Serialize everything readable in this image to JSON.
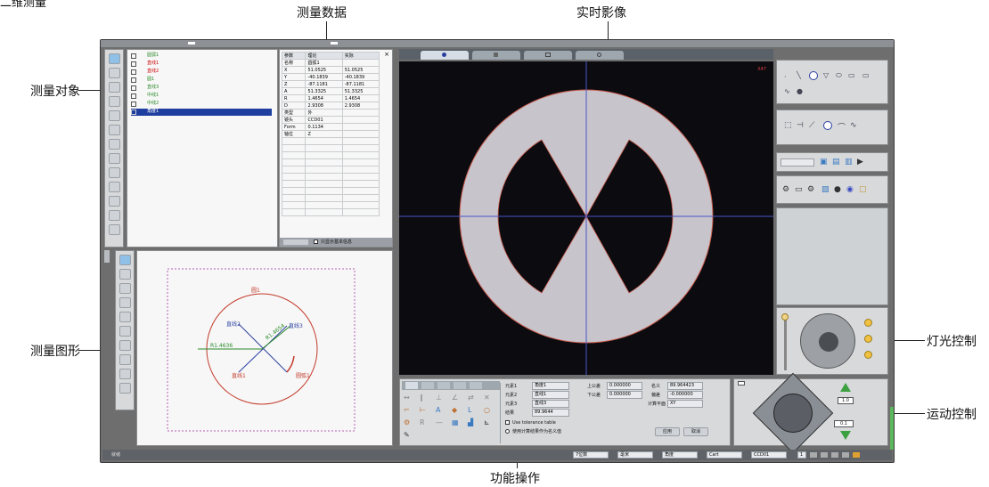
{
  "corner_title": "二维测量",
  "callouts": {
    "measurement_data": "测量数据",
    "live_image": "实时影像",
    "measurement_object": "测量对象",
    "measurement_graphic": "测量图形",
    "light_control": "灯光控制",
    "motion_control": "运动控制",
    "function_operation": "功能操作"
  },
  "object_tree": {
    "items": [
      "圆弧1",
      "直线1",
      "直线2",
      "圆1",
      "直线3",
      "中线1",
      "中线2",
      "角度1"
    ],
    "selected_index": 7
  },
  "data_table": {
    "headers": [
      "参数",
      "理论",
      "实际"
    ],
    "rows": [
      [
        "名称",
        "圆弧1",
        ""
      ],
      [
        "X",
        "51.0525",
        "51.0525"
      ],
      [
        "Y",
        "-40.1839",
        "-40.1839"
      ],
      [
        "Z",
        "-87.1181",
        "-87.1181"
      ],
      [
        "A",
        "51.3325",
        "51.3325"
      ],
      [
        "R",
        "1.4654",
        "1.4654"
      ],
      [
        "D",
        "2.9308",
        "2.9308"
      ],
      [
        "类型",
        "外",
        ""
      ],
      [
        "镜头",
        "CCD01",
        ""
      ],
      [
        "Form",
        "0.1134",
        ""
      ],
      [
        "轴位",
        "Z",
        ""
      ]
    ],
    "footer_checkbox": "只显示基本信息"
  },
  "graphic": {
    "labels": [
      "圆1",
      "直线2",
      "直线1",
      "直线3",
      "圆弧1"
    ],
    "dim_r": "R1.4636",
    "dim_r2": "R1.4654"
  },
  "live_view": {
    "badge": "X47",
    "tabs": [
      "camera",
      "measure",
      "window",
      "settings"
    ]
  },
  "function_panel": {
    "labels": {
      "element1": "元素1",
      "element2": "元素2",
      "element3": "元素3",
      "result": "结果",
      "upper": "上公差",
      "lower": "下公差",
      "nominal": "名义",
      "deviation": "偏差",
      "plane": "计算平面"
    },
    "values": {
      "element1": "角度1",
      "element2": "直线1",
      "element3": "直线3",
      "result": "89.9644",
      "upper": "0.000000",
      "lower": "0.000000",
      "nominal": "89.964423",
      "deviation": "-0.000000",
      "plane": "XY"
    },
    "check1": "Use tolerance table",
    "radio1": "使用计算结果作为名义值",
    "btn_ok": "应用",
    "btn_cancel": "取消"
  },
  "motion": {
    "speed_up": "1.0",
    "speed_down": "0.1"
  },
  "status_bar": {
    "left": "就绪",
    "dd1": "7位数",
    "dd2": "毫米",
    "dd3": "角度",
    "dd4": "Cart",
    "ccd": "CCD01",
    "page": "1"
  }
}
